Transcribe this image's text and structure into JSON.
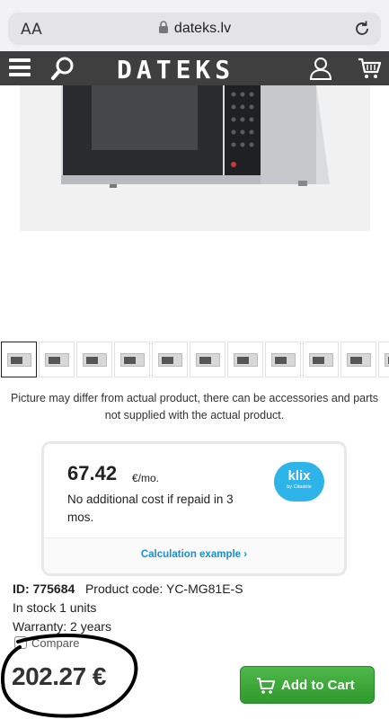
{
  "browser": {
    "text_size_label": "AA",
    "url": "dateks.lv"
  },
  "header": {
    "logo": "DATEKS"
  },
  "gallery": {
    "thumbnail_count": 11,
    "active_index": 0
  },
  "disclaimer": "Picture may differ from actual product, there can be accessories and parts not supplied with the actual product.",
  "klix": {
    "monthly_price": "67.42",
    "unit": "€/mo.",
    "note": "No additional cost if repaid in 3 mos.",
    "logo_text": "klix",
    "logo_subtext": "by Citadele",
    "calc_link": "Calculation example"
  },
  "product": {
    "id_label": "ID:",
    "id_value": "775684",
    "code_label": "Product code:",
    "code_value": "YC-MG81E-S",
    "stock": "In stock 1 units",
    "warranty": "Warranty: 2 years",
    "compare_label": "Compare",
    "price": "202.27 €",
    "add_to_cart": "Add to Cart"
  },
  "colors": {
    "header_bg": "#3f3f3f",
    "cart_button": "#3aa73a",
    "link": "#1b8fd0",
    "klix_brand": "#2fb4e9"
  }
}
